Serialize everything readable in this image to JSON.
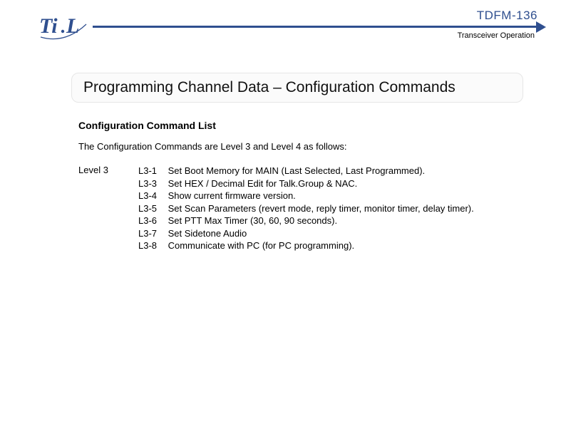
{
  "header": {
    "model": "TDFM-136",
    "section": "Transceiver Operation",
    "logo_alt": "TiL"
  },
  "title": "Programming Channel Data – Configuration Commands",
  "section": {
    "list_title": "Configuration Command List",
    "intro": "The Configuration Commands are Level 3 and Level 4 as follows:",
    "level_label": "Level 3",
    "commands": [
      {
        "code": "L3-1",
        "desc": "Set Boot Memory for MAIN (Last Selected, Last Programmed)."
      },
      {
        "code": "L3-3",
        "desc": "Set HEX / Decimal Edit for Talk.Group & NAC."
      },
      {
        "code": "L3-4",
        "desc": "Show current firmware version."
      },
      {
        "code": "L3-5",
        "desc": "Set Scan Parameters (revert mode, reply timer, monitor timer, delay timer)."
      },
      {
        "code": "L3-6",
        "desc": "Set PTT Max Timer (30, 60, 90 seconds)."
      },
      {
        "code": "L3-7",
        "desc": "Set Sidetone Audio"
      },
      {
        "code": "L3-8",
        "desc": "Communicate with PC (for PC programming)."
      }
    ]
  }
}
